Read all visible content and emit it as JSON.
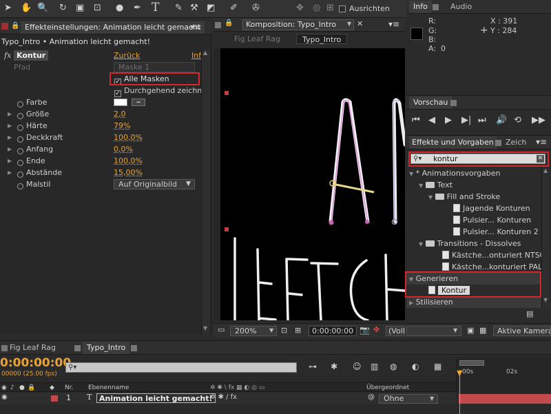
{
  "toolbar": {
    "ausrichten_label": "Ausrichten",
    "info_tab": "Info",
    "audio_tab": "Audio"
  },
  "effect_panel": {
    "tab_title": "Effekteinstellungen: Animation leicht gemacht",
    "breadcrumb": "Typo_Intro • Animation leicht gemacht!",
    "effect_name": "Kontur",
    "reset_label": "Zurück",
    "info_label": "Inf",
    "pfad_label": "Pfad",
    "pfad_value": "Maske 1",
    "alle_masken": "Alle Masken",
    "durchgehend": "Durchgehend zeichn",
    "properties": [
      {
        "label": "Farbe",
        "value": ""
      },
      {
        "label": "Größe",
        "value": "2,0"
      },
      {
        "label": "Härte",
        "value": "79%"
      },
      {
        "label": "Deckkraft",
        "value": "100,0%"
      },
      {
        "label": "Anfang",
        "value": "0,0%"
      },
      {
        "label": "Ende",
        "value": "100,0%"
      },
      {
        "label": "Abstände",
        "value": "15,00%"
      },
      {
        "label": "Malstil",
        "value": "Auf Originalbild"
      }
    ]
  },
  "comp_panel": {
    "tab_title": "Komposition: Typo_Intro",
    "crumb_prev": "Fig Leaf Rag",
    "crumb_current": "Typo_Intro",
    "zoom": "200%",
    "timecode": "0:00:00:00",
    "quality": "(Voll)",
    "camera": "Aktive Kamera"
  },
  "info_panel": {
    "r": "R:",
    "g": "G:",
    "b": "B:",
    "a": "A:  0",
    "x": "X : 391",
    "y": "Y : 284"
  },
  "preview_panel": {
    "title": "Vorschau"
  },
  "effects_panel": {
    "title": "Effekte und Vorgaben",
    "tab2": "Zeich",
    "search_value": "kontur",
    "tree": [
      {
        "label": "* Animationsvorgaben",
        "level": 0,
        "kind": "group"
      },
      {
        "label": "Text",
        "level": 1,
        "kind": "folder"
      },
      {
        "label": "Fill and Stroke",
        "level": 2,
        "kind": "folder"
      },
      {
        "label": "Jagende Konturen",
        "level": 3,
        "kind": "file"
      },
      {
        "label": "Pulsier... Konturen",
        "level": 3,
        "kind": "file"
      },
      {
        "label": "Pulsier... Konturen 2",
        "level": 3,
        "kind": "file"
      },
      {
        "label": "Transitions - Dissolves",
        "level": 1,
        "kind": "folder"
      },
      {
        "label": "Kästche...onturiert NTSC",
        "level": 2,
        "kind": "file"
      },
      {
        "label": "Kästche...konturiert PAL",
        "level": 2,
        "kind": "file"
      }
    ],
    "generieren": "Generieren",
    "kontur_item": "Kontur",
    "stilisieren": "Stilisieren"
  },
  "timeline": {
    "tab1": "Fig Leaf Rag",
    "tab2": "Typo_Intro",
    "timecode": "0:00:00:00",
    "fps": "00000 (25.00 fps)",
    "col_nr": "Nr.",
    "col_name": "Ebenenname",
    "col_parent": "Übergeordnet",
    "layer_num": "1",
    "layer_name": "Animation leicht gemacht!",
    "parent_value": "Ohne",
    "ruler_0": "00s",
    "ruler_2": "02s"
  },
  "colors": {
    "accent_red": "#d8262c",
    "value_orange": "#e8a33a",
    "layer_bar": "#c24a4a"
  }
}
